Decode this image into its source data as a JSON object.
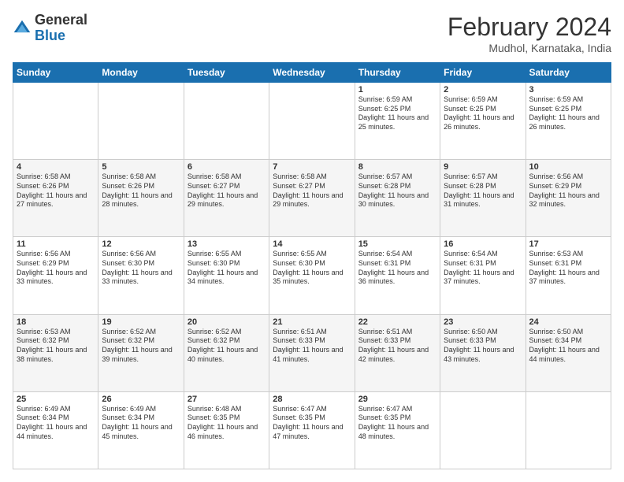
{
  "header": {
    "logo": {
      "general": "General",
      "blue": "Blue"
    },
    "title": "February 2024",
    "subtitle": "Mudhol, Karnataka, India"
  },
  "calendar": {
    "weekdays": [
      "Sunday",
      "Monday",
      "Tuesday",
      "Wednesday",
      "Thursday",
      "Friday",
      "Saturday"
    ],
    "weeks": [
      [
        {
          "day": "",
          "info": ""
        },
        {
          "day": "",
          "info": ""
        },
        {
          "day": "",
          "info": ""
        },
        {
          "day": "",
          "info": ""
        },
        {
          "day": "1",
          "info": "Sunrise: 6:59 AM\nSunset: 6:25 PM\nDaylight: 11 hours and 25 minutes."
        },
        {
          "day": "2",
          "info": "Sunrise: 6:59 AM\nSunset: 6:25 PM\nDaylight: 11 hours and 26 minutes."
        },
        {
          "day": "3",
          "info": "Sunrise: 6:59 AM\nSunset: 6:25 PM\nDaylight: 11 hours and 26 minutes."
        }
      ],
      [
        {
          "day": "4",
          "info": "Sunrise: 6:58 AM\nSunset: 6:26 PM\nDaylight: 11 hours and 27 minutes."
        },
        {
          "day": "5",
          "info": "Sunrise: 6:58 AM\nSunset: 6:26 PM\nDaylight: 11 hours and 28 minutes."
        },
        {
          "day": "6",
          "info": "Sunrise: 6:58 AM\nSunset: 6:27 PM\nDaylight: 11 hours and 29 minutes."
        },
        {
          "day": "7",
          "info": "Sunrise: 6:58 AM\nSunset: 6:27 PM\nDaylight: 11 hours and 29 minutes."
        },
        {
          "day": "8",
          "info": "Sunrise: 6:57 AM\nSunset: 6:28 PM\nDaylight: 11 hours and 30 minutes."
        },
        {
          "day": "9",
          "info": "Sunrise: 6:57 AM\nSunset: 6:28 PM\nDaylight: 11 hours and 31 minutes."
        },
        {
          "day": "10",
          "info": "Sunrise: 6:56 AM\nSunset: 6:29 PM\nDaylight: 11 hours and 32 minutes."
        }
      ],
      [
        {
          "day": "11",
          "info": "Sunrise: 6:56 AM\nSunset: 6:29 PM\nDaylight: 11 hours and 33 minutes."
        },
        {
          "day": "12",
          "info": "Sunrise: 6:56 AM\nSunset: 6:30 PM\nDaylight: 11 hours and 33 minutes."
        },
        {
          "day": "13",
          "info": "Sunrise: 6:55 AM\nSunset: 6:30 PM\nDaylight: 11 hours and 34 minutes."
        },
        {
          "day": "14",
          "info": "Sunrise: 6:55 AM\nSunset: 6:30 PM\nDaylight: 11 hours and 35 minutes."
        },
        {
          "day": "15",
          "info": "Sunrise: 6:54 AM\nSunset: 6:31 PM\nDaylight: 11 hours and 36 minutes."
        },
        {
          "day": "16",
          "info": "Sunrise: 6:54 AM\nSunset: 6:31 PM\nDaylight: 11 hours and 37 minutes."
        },
        {
          "day": "17",
          "info": "Sunrise: 6:53 AM\nSunset: 6:31 PM\nDaylight: 11 hours and 37 minutes."
        }
      ],
      [
        {
          "day": "18",
          "info": "Sunrise: 6:53 AM\nSunset: 6:32 PM\nDaylight: 11 hours and 38 minutes."
        },
        {
          "day": "19",
          "info": "Sunrise: 6:52 AM\nSunset: 6:32 PM\nDaylight: 11 hours and 39 minutes."
        },
        {
          "day": "20",
          "info": "Sunrise: 6:52 AM\nSunset: 6:32 PM\nDaylight: 11 hours and 40 minutes."
        },
        {
          "day": "21",
          "info": "Sunrise: 6:51 AM\nSunset: 6:33 PM\nDaylight: 11 hours and 41 minutes."
        },
        {
          "day": "22",
          "info": "Sunrise: 6:51 AM\nSunset: 6:33 PM\nDaylight: 11 hours and 42 minutes."
        },
        {
          "day": "23",
          "info": "Sunrise: 6:50 AM\nSunset: 6:33 PM\nDaylight: 11 hours and 43 minutes."
        },
        {
          "day": "24",
          "info": "Sunrise: 6:50 AM\nSunset: 6:34 PM\nDaylight: 11 hours and 44 minutes."
        }
      ],
      [
        {
          "day": "25",
          "info": "Sunrise: 6:49 AM\nSunset: 6:34 PM\nDaylight: 11 hours and 44 minutes."
        },
        {
          "day": "26",
          "info": "Sunrise: 6:49 AM\nSunset: 6:34 PM\nDaylight: 11 hours and 45 minutes."
        },
        {
          "day": "27",
          "info": "Sunrise: 6:48 AM\nSunset: 6:35 PM\nDaylight: 11 hours and 46 minutes."
        },
        {
          "day": "28",
          "info": "Sunrise: 6:47 AM\nSunset: 6:35 PM\nDaylight: 11 hours and 47 minutes."
        },
        {
          "day": "29",
          "info": "Sunrise: 6:47 AM\nSunset: 6:35 PM\nDaylight: 11 hours and 48 minutes."
        },
        {
          "day": "",
          "info": ""
        },
        {
          "day": "",
          "info": ""
        }
      ]
    ]
  }
}
